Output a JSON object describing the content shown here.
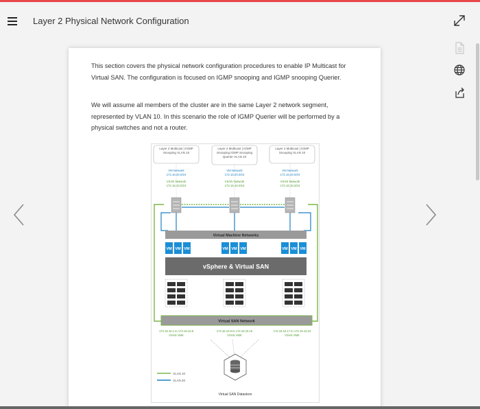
{
  "header": {
    "title": "Layer 2 Physical Network Configuration"
  },
  "icons": {
    "menu": "hamburger-icon",
    "expand": "expand-icon",
    "document": "document-icon",
    "language": "globe-icon",
    "share": "share-icon",
    "prev": "chevron-left-icon",
    "next": "chevron-right-icon"
  },
  "content": {
    "paragraph1": "This section covers the physical network configuration procedures to enable IP Multicast for Virtual SAN. The configuration is focused on IGMP snooping and IGMP snooping Querier.",
    "paragraph2": "We will assume all members of the cluster are in the same Layer 2 network segment, represented by VLAN 10. In this scenario the role of IGMP Querier will be performed by a physical switches and not a router."
  },
  "diagram": {
    "callouts": [
      "Layer 2 Multicast | IGMP Snooping VLAN 10",
      "Layer 2 Multicast | IGMP Snooping IGMP Snooping Querier VLAN 10",
      "Layer 2 Multicast | IGMP Snooping VLAN 10"
    ],
    "host_labels": [
      {
        "vm": "VM Network",
        "vm_ip": "172.16.20.0/24",
        "vsan": "VSAN Network",
        "vsan_ip": "172.16.10.0/24"
      },
      {
        "vm": "VM Network",
        "vm_ip": "172.16.20.0/24",
        "vsan": "VSAN Network",
        "vsan_ip": "172.16.10.0/24"
      },
      {
        "vm": "VM Network",
        "vm_ip": "172.16.20.0/24",
        "vsan": "VSAN Network",
        "vsan_ip": "172.16.10.0/24"
      }
    ],
    "vm_network_label": "Virtual Machine Networks",
    "vm_label": "VM",
    "vsphere_label": "vSphere & Virtual SAN",
    "vsan_network_label": "Virtual SAN Network",
    "vmk_labels": [
      {
        "range": "172.16.10.1 to 172.16.10.8",
        "vmk": "VSAN VMK"
      },
      {
        "range": "172.16.10.9 to 172.16.10.16",
        "vmk": "VSAN VMK"
      },
      {
        "range": "172.16.10.17 to 172.16.10.24",
        "vmk": "VSAN VMK"
      }
    ],
    "legend": [
      {
        "label": "VLAN 10",
        "color": "#7ab648"
      },
      {
        "label": "VLAN 20",
        "color": "#1a7fc4"
      }
    ],
    "datastore_label": "Virtual SAN Datastore"
  },
  "colors": {
    "accent": "#e8474a",
    "vlan10": "#7ab648",
    "vlan20": "#1a7fc4",
    "vm_blue": "#1a8ed6",
    "gray_band": "#9a9a9a"
  }
}
